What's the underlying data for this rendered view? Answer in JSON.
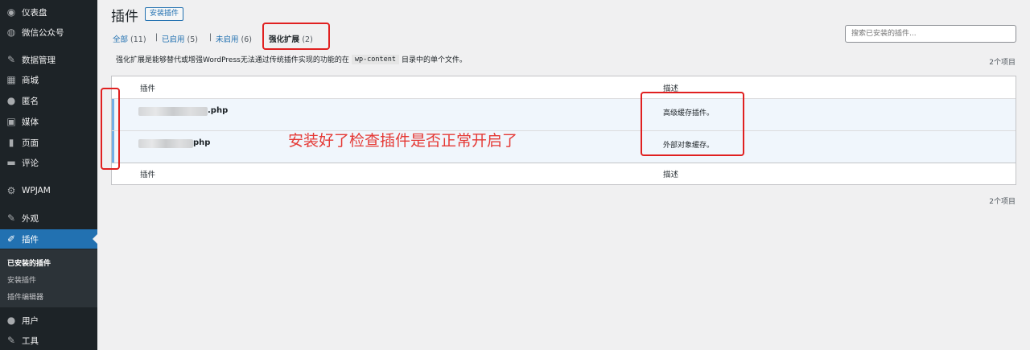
{
  "sidebar": {
    "items": [
      {
        "label": "仪表盘",
        "icon": "dashboard-icon",
        "glyph": "◉"
      },
      {
        "label": "微信公众号",
        "icon": "wechat-icon",
        "glyph": "◍"
      },
      {
        "label": "数据管理",
        "icon": "pin-icon",
        "glyph": "✎"
      },
      {
        "label": "商城",
        "icon": "store-icon",
        "glyph": "▦"
      },
      {
        "label": "匿名",
        "icon": "comment-bubble-icon",
        "glyph": "●"
      },
      {
        "label": "媒体",
        "icon": "media-icon",
        "glyph": "▣"
      },
      {
        "label": "页面",
        "icon": "page-icon",
        "glyph": "▮"
      },
      {
        "label": "评论",
        "icon": "comment-icon",
        "glyph": "▬"
      },
      {
        "label": "WPJAM",
        "icon": "gear-icon",
        "glyph": "⚙"
      },
      {
        "label": "外观",
        "icon": "appearance-icon",
        "glyph": "✎"
      },
      {
        "label": "插件",
        "icon": "plugin-icon",
        "glyph": "✐"
      },
      {
        "label": "用户",
        "icon": "user-icon",
        "glyph": "●"
      },
      {
        "label": "工具",
        "icon": "wrench-icon",
        "glyph": "✎"
      }
    ],
    "submenu": [
      "已安装的插件",
      "安装插件",
      "插件编辑器"
    ]
  },
  "header": {
    "title": "插件",
    "add_button": "安装插件"
  },
  "filters": {
    "all": {
      "label": "全部",
      "count": "(11)"
    },
    "active": {
      "label": "已启用",
      "count": "(5)"
    },
    "inactive": {
      "label": "未启用",
      "count": "(6)"
    },
    "dropins": {
      "label": "强化扩展",
      "count": "(2)"
    },
    "separator": "|"
  },
  "search": {
    "placeholder": "搜索已安装的插件..."
  },
  "description": {
    "before": "强化扩展是能够替代或增强WordPress无法通过传统插件实现的功能的在",
    "code": "wp-content",
    "after": "目录中的单个文件。"
  },
  "item_count": "2个项目",
  "table": {
    "col_plugin": "插件",
    "col_desc": "描述",
    "rows": [
      {
        "name_suffix": ".php",
        "desc": "高级缓存插件。"
      },
      {
        "name_suffix": "php",
        "desc": "外部对象缓存。"
      }
    ]
  },
  "annotation": "安装好了检查插件是否正常开启了",
  "colors": {
    "sidebar_bg": "#1d2327",
    "accent": "#2271b1",
    "annotation_red": "#e02020"
  }
}
